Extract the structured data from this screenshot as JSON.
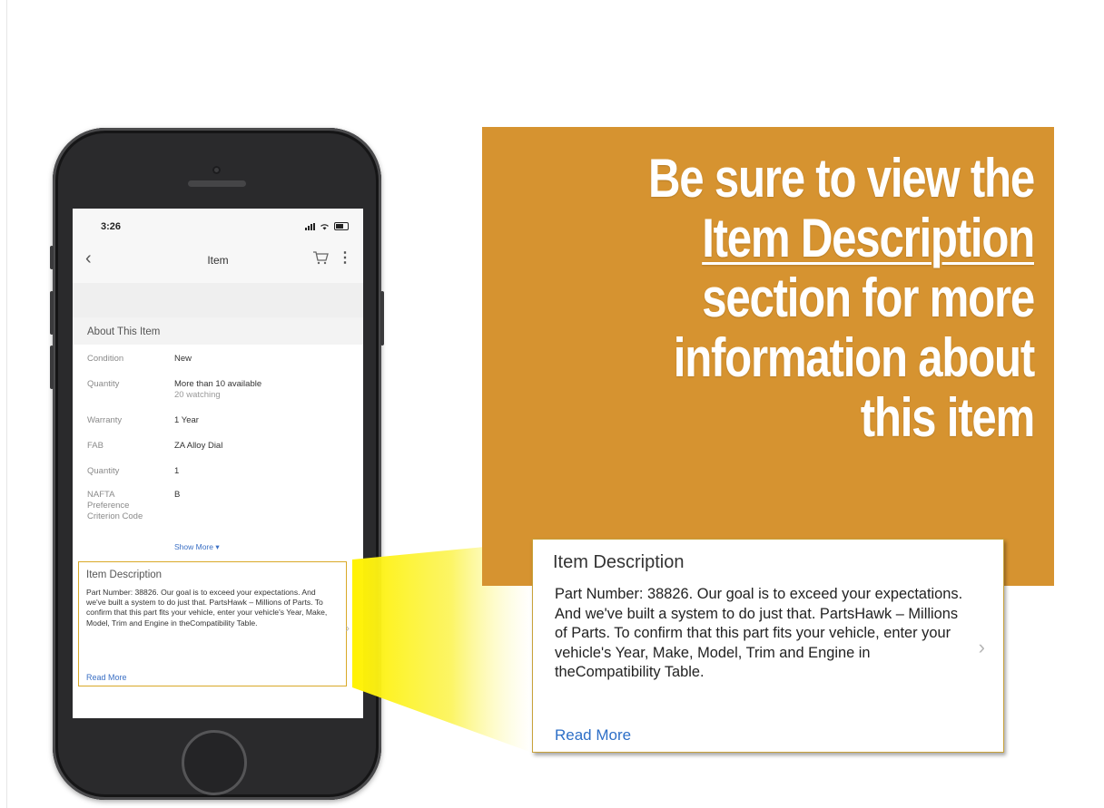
{
  "phone": {
    "status_time": "3:26",
    "nav_title": "Item",
    "about_header": "About This Item",
    "specs": [
      {
        "label": "Condition",
        "value": "New",
        "sub": ""
      },
      {
        "label": "Quantity",
        "value": "More than 10 available",
        "sub": "20 watching"
      },
      {
        "label": "Warranty",
        "value": "1 Year",
        "sub": ""
      },
      {
        "label": "FAB",
        "value": "ZA Alloy Dial",
        "sub": ""
      },
      {
        "label": "Quantity",
        "value": "1",
        "sub": ""
      },
      {
        "label": "NAFTA Preference Criterion Code",
        "value": "B",
        "sub": ""
      }
    ],
    "show_more": "Show More ▾",
    "item_description": {
      "title": "Item Description",
      "body": "Part Number: 38826. Our goal is to exceed your expectations. And we've built a system to do just that. PartsHawk – Millions of Parts. To confirm that this part fits your vehicle, enter your vehicle's Year, Make, Model, Trim and Engine in theCompatibility Table.",
      "read_more": "Read More"
    }
  },
  "banner": {
    "line1": "Be sure to view the",
    "line2": "Item Description",
    "line3": "section for more",
    "line4": "information about",
    "line5": "this item",
    "background_color": "#d69330"
  },
  "zoom_card": {
    "title": "Item Description",
    "body": "Part Number: 38826. Our goal is to exceed your expectations. And we've built a system to do just that. PartsHawk – Millions of Parts. To confirm that this part fits your vehicle, enter your vehicle's Year, Make, Model, Trim and Engine in theCompatibility Table.",
    "read_more": "Read More",
    "link_color": "#2e6fc7"
  }
}
